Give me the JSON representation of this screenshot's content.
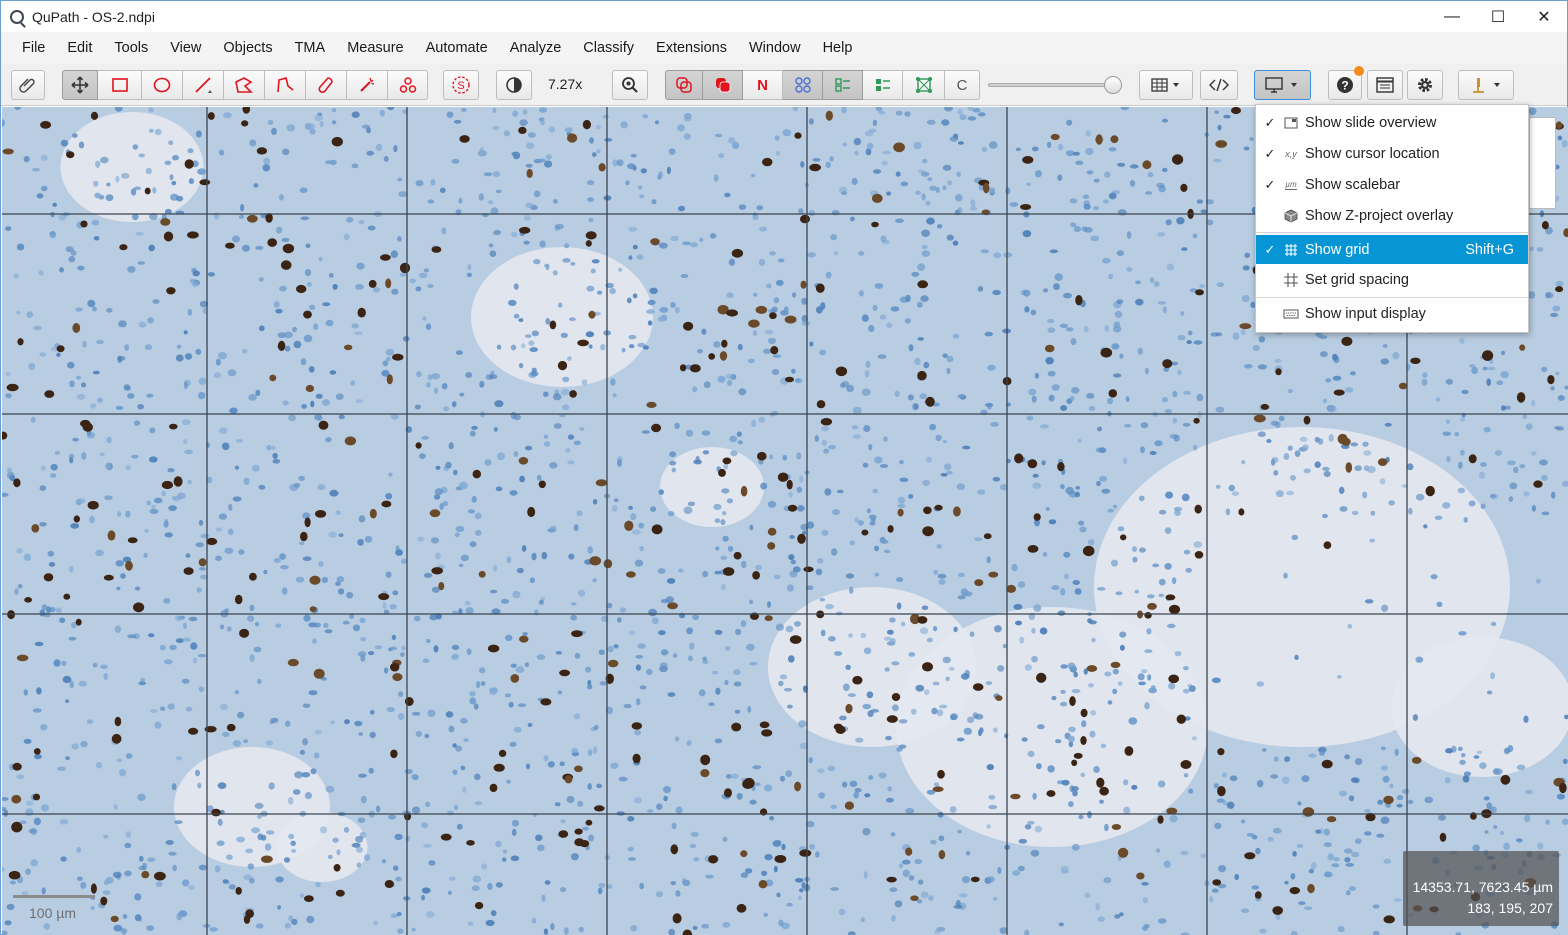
{
  "window": {
    "title": "QuPath - OS-2.ndpi",
    "minimize": "—",
    "maximize": "☐",
    "close": "✕"
  },
  "menu": [
    "File",
    "Edit",
    "Tools",
    "View",
    "Objects",
    "TMA",
    "Measure",
    "Automate",
    "Analyze",
    "Classify",
    "Extensions",
    "Window",
    "Help"
  ],
  "toolbar": {
    "zoom_label": "7.27x",
    "channel_button": "C",
    "counting_button": "N",
    "colors": {
      "annotation_red": "#e0141e",
      "accent_blue": "#0696d6",
      "notify_orange": "#f58a1f",
      "green": "#2e9a5a"
    }
  },
  "dropdown": {
    "items": [
      {
        "label": "Show slide overview",
        "checked": true,
        "icon": "overview-icon",
        "accel": ""
      },
      {
        "label": "Show cursor location",
        "checked": true,
        "icon": "xy-icon",
        "accel": ""
      },
      {
        "label": "Show scalebar",
        "checked": true,
        "icon": "scalebar-icon",
        "accel": ""
      },
      {
        "label": "Show Z-project overlay",
        "checked": false,
        "icon": "cube-icon",
        "accel": ""
      },
      {
        "label": "Show grid",
        "checked": true,
        "icon": "grid-icon",
        "accel": "Shift+G",
        "active": true
      },
      {
        "label": "Set grid spacing",
        "checked": false,
        "icon": "hash-icon",
        "accel": ""
      },
      {
        "label": "Show input display",
        "checked": false,
        "icon": "keyboard-icon",
        "accel": ""
      }
    ],
    "check_glyph": "✓",
    "xy_glyph": "x,y",
    "scalebar_glyph": "µm"
  },
  "viewer": {
    "scalebar_label": "100 µm",
    "cursor_location": "14353.71, 7623.45 µm",
    "pixel_value": "183, 195, 207"
  }
}
